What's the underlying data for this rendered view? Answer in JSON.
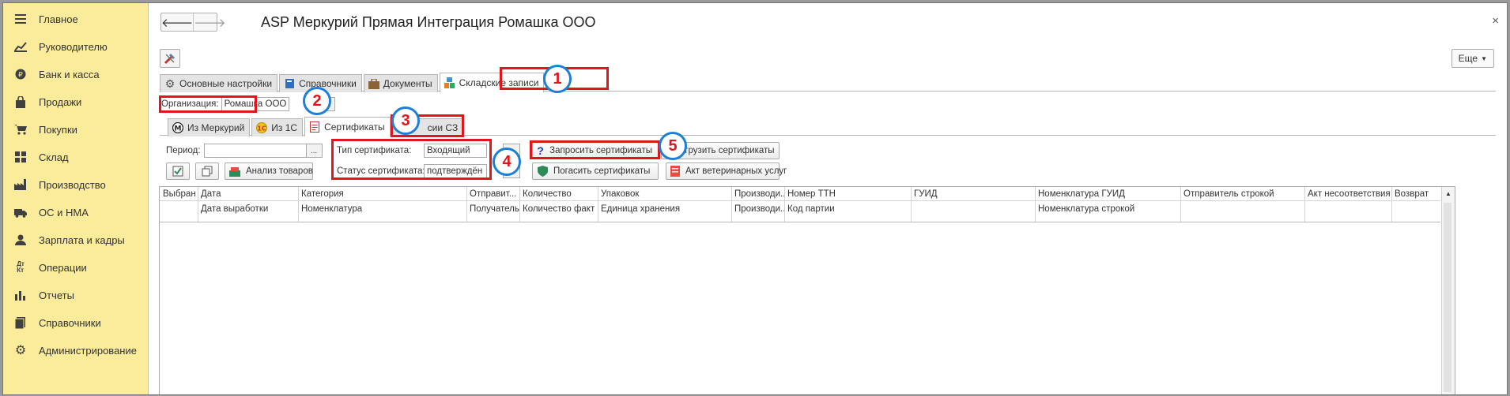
{
  "sidebar": {
    "items": [
      {
        "label": "Главное",
        "icon": "menu-icon"
      },
      {
        "label": "Руководителю",
        "icon": "chart-line-icon"
      },
      {
        "label": "Банк и касса",
        "icon": "coin-icon"
      },
      {
        "label": "Продажи",
        "icon": "bag-icon"
      },
      {
        "label": "Покупки",
        "icon": "cart-icon"
      },
      {
        "label": "Склад",
        "icon": "warehouse-icon"
      },
      {
        "label": "Производство",
        "icon": "factory-icon"
      },
      {
        "label": "ОС и НМА",
        "icon": "truck-icon"
      },
      {
        "label": "Зарплата и кадры",
        "icon": "person-icon"
      },
      {
        "label": "Операции",
        "icon": "operations-icon"
      },
      {
        "label": "Отчеты",
        "icon": "bar-chart-icon"
      },
      {
        "label": "Справочники",
        "icon": "book-icon"
      },
      {
        "label": "Администрирование",
        "icon": "gear-icon"
      }
    ]
  },
  "header": {
    "title": "ASP Меркурий Прямая Интеграция Ромашка ООО",
    "more_label": "Еще",
    "close_glyph": "×"
  },
  "main_tabs": [
    {
      "label": "Основные настройки",
      "icon": "gear-icon"
    },
    {
      "label": "Справочники",
      "icon": "book-icon"
    },
    {
      "label": "Документы",
      "icon": "briefcase-icon"
    },
    {
      "label": "Складские записи",
      "icon": "blocks-icon",
      "active": true
    }
  ],
  "organization": {
    "label": "Организация:",
    "value": "Ромашка ООО"
  },
  "sub_tabs": [
    {
      "label": "Из Меркурий",
      "icon": "mercury-icon"
    },
    {
      "label": "Из 1С",
      "icon": "one-c-icon"
    },
    {
      "label": "Сертификаты",
      "icon": "document-icon",
      "active": true
    },
    {
      "label": "сии СЗ",
      "icon": "none"
    }
  ],
  "filters": {
    "period_label": "Период:",
    "period_value": "",
    "period_btn": "...",
    "cert_type_label": "Тип сертификата:",
    "cert_type_value": "Входящий",
    "cert_status_label": "Статус сертификата:",
    "cert_status_value": "подтверждён"
  },
  "buttons": {
    "analysis": "Анализ товаров",
    "request_certs": "Запросить сертификаты",
    "load_certs": "Загрузить сертификаты",
    "redeem_certs": "Погасить сертификаты",
    "vet_act": "Акт ветеринарных услуг"
  },
  "table": {
    "header_row1": [
      "Выбран",
      "Дата",
      "Категория",
      "Отправит...",
      "Количество",
      "Упаковок",
      "Производи...",
      "Номер ТТН",
      "ГУИД",
      "Номенклатура ГУИД",
      "Отправитель строкой",
      "Акт несоответствия",
      "Возврат"
    ],
    "header_row2": [
      "",
      "Дата выработки",
      "Номенклатура",
      "Получатель",
      "Количество факт",
      "Единица хранения",
      "Производи...",
      "Код партии",
      "",
      "Номенклатура строкой",
      "",
      "",
      ""
    ]
  },
  "callouts": [
    "1",
    "2",
    "3",
    "4",
    "5"
  ],
  "colors": {
    "sidebar_bg": "#fbec9c",
    "highlight": "#e0161d",
    "callout_ring": "#1d7fd6"
  }
}
